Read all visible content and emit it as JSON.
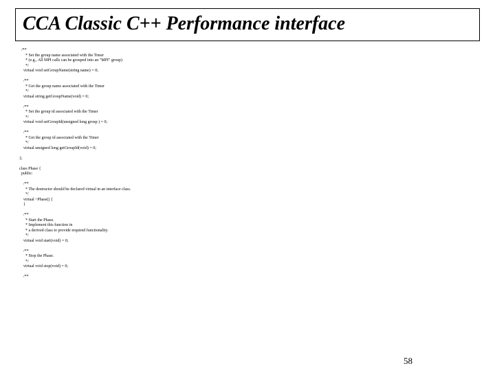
{
  "title": "CCA Classic C++ Performance interface",
  "page_number": "58",
  "code": "  /**\n      * Set the group name associated with the Timer\n      * (e.g., All MPI calls can be grouped into an \"MPI\" group)\n      */\n    virtual void setGroupName(string name) = 0;\n\n    /**\n      * Get the group name associated with the Timer\n      */\n    virtual string getGroupName(void) = 0;\n\n    /**\n      * Set the group id associated with the Timer\n      */\n    virtual void setGroupId(unsigned long group ) = 0;\n\n    /**\n      * Get the group id associated with the Timer\n      */\n    virtual unsigned long getGroupId(void) = 0;\n\n};\n\nclass Phase {\n  public:\n\n    /**\n      * The destructor should be declared virtual in an interface class.\n      */\n    virtual ~Phase() {\n    }\n\n    /**\n      * Start the Phase.\n      * Implement this function in\n      * a derived class to provide required functionality.\n      */\n    virtual void start(void) = 0;\n\n    /**\n      * Stop the Phase.\n      */\n    virtual void stop(void) = 0;\n\n    /**"
}
